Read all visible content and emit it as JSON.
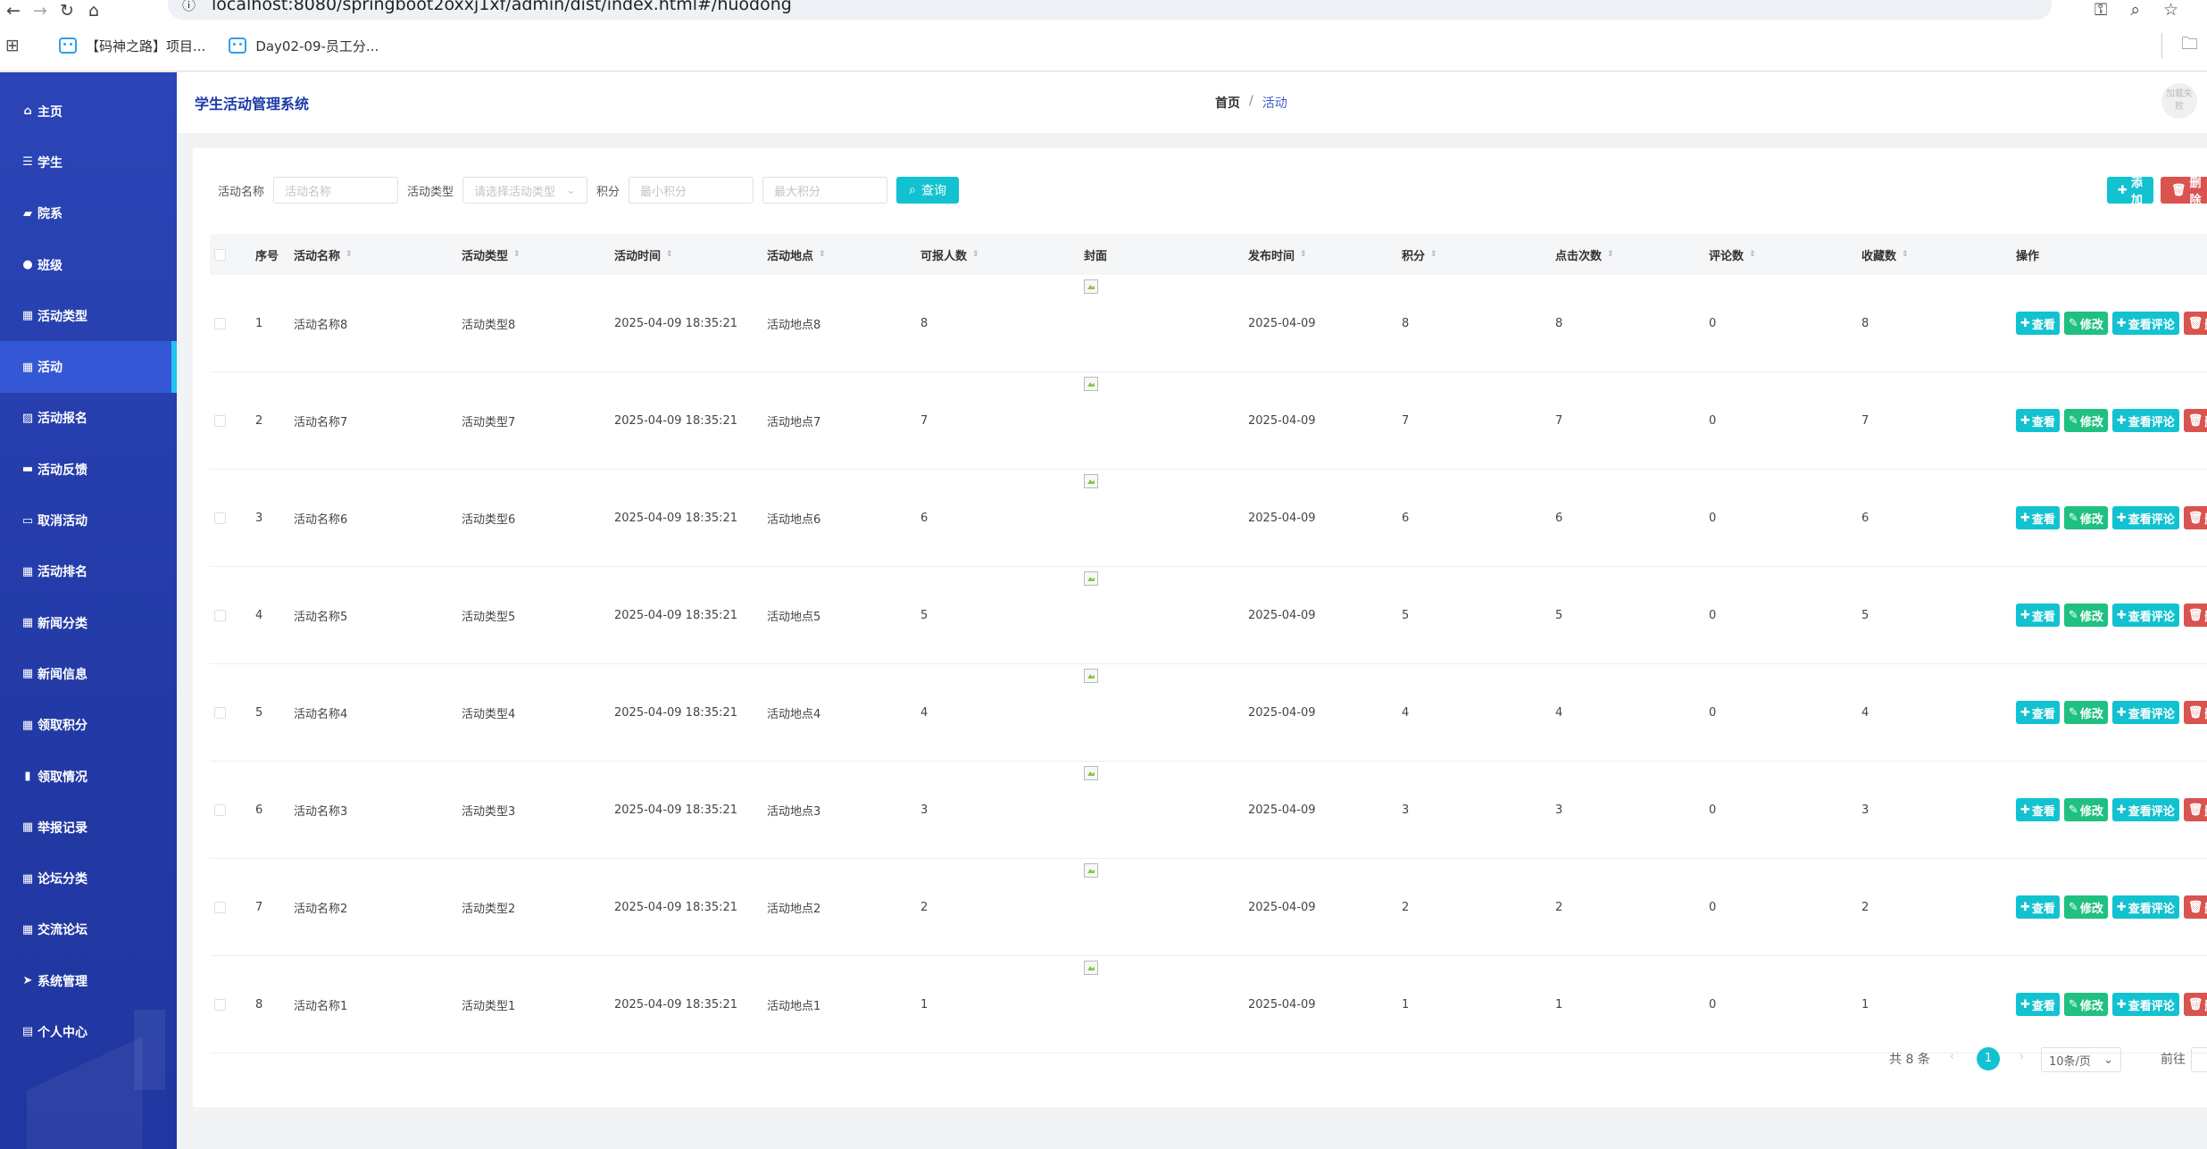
{
  "browser": {
    "url": "localhost:8080/springboot2oxxj1xf/admin/dist/index.html#/huodong",
    "bookmarks": [
      "【码神之路】项目...",
      "Day02-09-员工分..."
    ]
  },
  "sidebar": {
    "items": [
      {
        "label": "主页",
        "icon": "home-icon"
      },
      {
        "label": "学生",
        "icon": "list-icon"
      },
      {
        "label": "院系",
        "icon": "briefcase-icon"
      },
      {
        "label": "班级",
        "icon": "user-icon"
      },
      {
        "label": "活动类型",
        "icon": "grid-icon"
      },
      {
        "label": "活动",
        "icon": "grid-icon",
        "active": true
      },
      {
        "label": "活动报名",
        "icon": "picture-icon"
      },
      {
        "label": "活动反馈",
        "icon": "monitor-icon"
      },
      {
        "label": "取消活动",
        "icon": "message-icon"
      },
      {
        "label": "活动排名",
        "icon": "grid-icon"
      },
      {
        "label": "新闻分类",
        "icon": "grid-icon"
      },
      {
        "label": "新闻信息",
        "icon": "grid-icon"
      },
      {
        "label": "领取积分",
        "icon": "grid-icon"
      },
      {
        "label": "领取情况",
        "icon": "bar-chart-icon"
      },
      {
        "label": "举报记录",
        "icon": "grid-icon"
      },
      {
        "label": "论坛分类",
        "icon": "grid-icon"
      },
      {
        "label": "交流论坛",
        "icon": "grid-icon"
      },
      {
        "label": "系统管理",
        "icon": "send-icon"
      },
      {
        "label": "个人中心",
        "icon": "card-icon"
      }
    ]
  },
  "header": {
    "title": "学生活动管理系统",
    "breadcrumb_home": "首页",
    "breadcrumb_sep": "/",
    "breadcrumb_current": "活动",
    "avatar_alt": "加载失败"
  },
  "search": {
    "name_label": "活动名称",
    "name_placeholder": "活动名称",
    "type_label": "活动类型",
    "type_placeholder": "请选择活动类型",
    "score_label": "积分",
    "min_placeholder": "最小积分",
    "max_placeholder": "最大积分",
    "query_button": "查询"
  },
  "toolbar": {
    "add_label": "添加",
    "delete_label": "删除"
  },
  "table": {
    "headers": [
      "序号",
      "活动名称",
      "活动类型",
      "活动时间",
      "活动地点",
      "可报人数",
      "封面",
      "发布时间",
      "积分",
      "点击次数",
      "评论数",
      "收藏数",
      "操作"
    ],
    "op_labels": {
      "view": "查看",
      "edit": "修改",
      "comments": "查看评论",
      "delete": "删除"
    },
    "rows": [
      {
        "no": "1",
        "name": "活动名称8",
        "type": "活动类型8",
        "time": "2025-04-09 18:35:21",
        "place": "活动地点8",
        "quota": "8",
        "publish": "2025-04-09",
        "score": "8",
        "clicks": "8",
        "comments": "0",
        "favs": "8"
      },
      {
        "no": "2",
        "name": "活动名称7",
        "type": "活动类型7",
        "time": "2025-04-09 18:35:21",
        "place": "活动地点7",
        "quota": "7",
        "publish": "2025-04-09",
        "score": "7",
        "clicks": "7",
        "comments": "0",
        "favs": "7"
      },
      {
        "no": "3",
        "name": "活动名称6",
        "type": "活动类型6",
        "time": "2025-04-09 18:35:21",
        "place": "活动地点6",
        "quota": "6",
        "publish": "2025-04-09",
        "score": "6",
        "clicks": "6",
        "comments": "0",
        "favs": "6"
      },
      {
        "no": "4",
        "name": "活动名称5",
        "type": "活动类型5",
        "time": "2025-04-09 18:35:21",
        "place": "活动地点5",
        "quota": "5",
        "publish": "2025-04-09",
        "score": "5",
        "clicks": "5",
        "comments": "0",
        "favs": "5"
      },
      {
        "no": "5",
        "name": "活动名称4",
        "type": "活动类型4",
        "time": "2025-04-09 18:35:21",
        "place": "活动地点4",
        "quota": "4",
        "publish": "2025-04-09",
        "score": "4",
        "clicks": "4",
        "comments": "0",
        "favs": "4"
      },
      {
        "no": "6",
        "name": "活动名称3",
        "type": "活动类型3",
        "time": "2025-04-09 18:35:21",
        "place": "活动地点3",
        "quota": "3",
        "publish": "2025-04-09",
        "score": "3",
        "clicks": "3",
        "comments": "0",
        "favs": "3"
      },
      {
        "no": "7",
        "name": "活动名称2",
        "type": "活动类型2",
        "time": "2025-04-09 18:35:21",
        "place": "活动地点2",
        "quota": "2",
        "publish": "2025-04-09",
        "score": "2",
        "clicks": "2",
        "comments": "0",
        "favs": "2"
      },
      {
        "no": "8",
        "name": "活动名称1",
        "type": "活动类型1",
        "time": "2025-04-09 18:35:21",
        "place": "活动地点1",
        "quota": "1",
        "publish": "2025-04-09",
        "score": "1",
        "clicks": "1",
        "comments": "0",
        "favs": "1"
      }
    ]
  },
  "pagination": {
    "total": "共 8 条",
    "current_page": "1",
    "page_size": "10条/页",
    "goto_label": "前往"
  }
}
